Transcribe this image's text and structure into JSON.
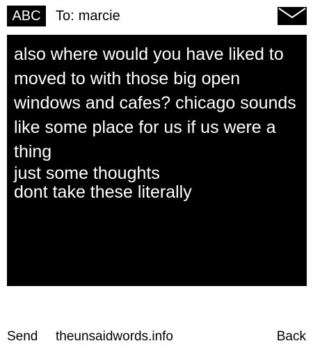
{
  "header": {
    "input_mode": "ABC",
    "to_prefix": "To:",
    "recipient": "marcie",
    "mail_icon": "envelope-icon"
  },
  "message": {
    "body": "also where would you have liked to moved to with those big open windows and cafes? chicago sounds like some place for us if us were a thing",
    "extra_lines": [
      "just some thoughts",
      "dont take these literally"
    ]
  },
  "softkeys": {
    "left": "Send",
    "center": "theunsaidwords.info",
    "right": "Back"
  },
  "colors": {
    "background": "#ffffff",
    "message_background": "#000000",
    "message_text": "#ffffff",
    "text": "#000000"
  }
}
